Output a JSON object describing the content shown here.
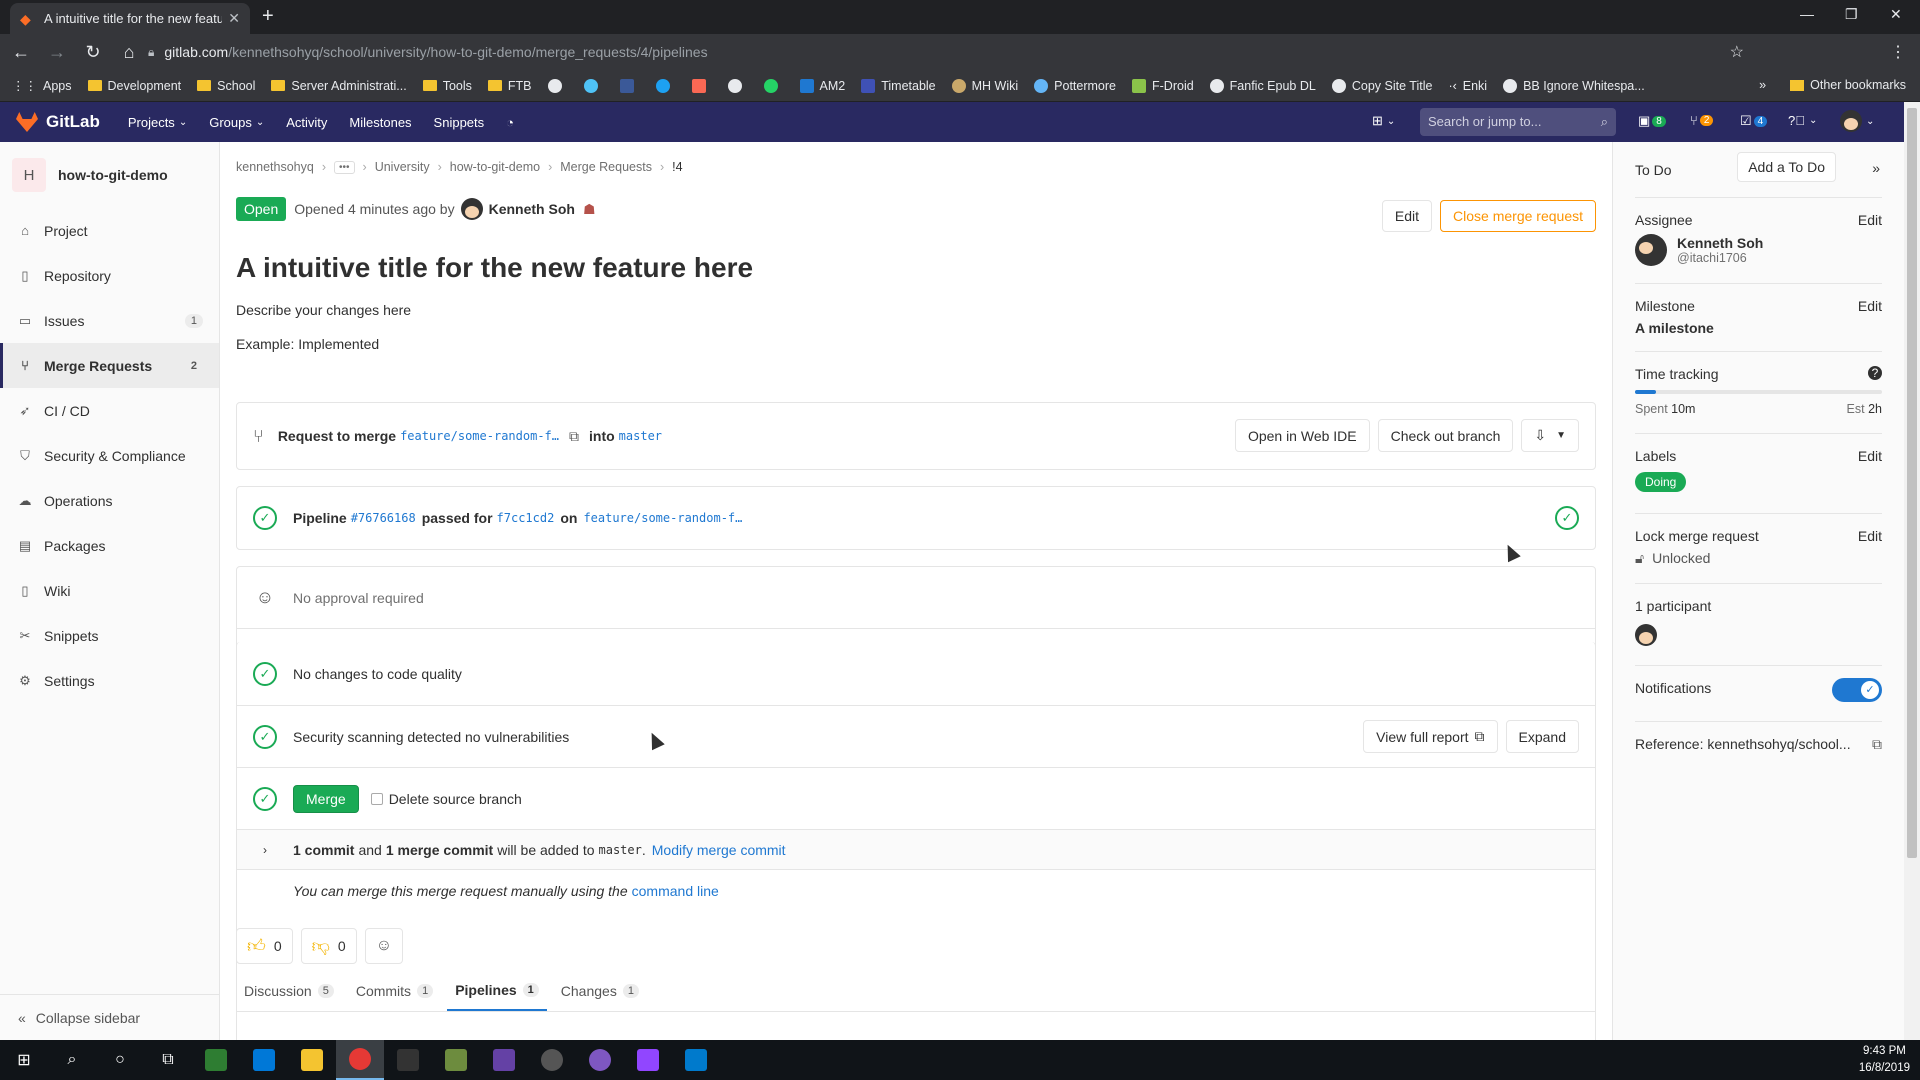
{
  "browser": {
    "tab_title": "A intuitive title for the new feature here",
    "url_host": "gitlab.com",
    "url_path": "/kennethsohyq/school/university/how-to-git-demo/merge_requests/4/pipelines",
    "bookmarks": [
      "Apps",
      "Development",
      "School",
      "Server Administrati...",
      "Tools",
      "FTB",
      "AM2",
      "Timetable",
      "MH Wiki",
      "Pottermore",
      "F-Droid",
      "Fanfic Epub DL",
      "Copy Site Title",
      "Enki",
      "BB Ignore Whitespa..."
    ],
    "other_bookmarks": "Other bookmarks"
  },
  "gitlab_nav": {
    "brand": "GitLab",
    "links": [
      "Projects",
      "Groups",
      "Activity",
      "Milestones",
      "Snippets"
    ],
    "search_placeholder": "Search or jump to...",
    "issues_badge": "8",
    "mr_badge": "2",
    "todo_badge": "4"
  },
  "sidebar": {
    "project_initial": "H",
    "project_name": "how-to-git-demo",
    "items": [
      {
        "label": "Project",
        "icon": "home-icon"
      },
      {
        "label": "Repository",
        "icon": "book-icon"
      },
      {
        "label": "Issues",
        "icon": "issues-icon",
        "count": "1"
      },
      {
        "label": "Merge Requests",
        "icon": "merge-request-icon",
        "count": "2"
      },
      {
        "label": "CI / CD",
        "icon": "rocket-icon"
      },
      {
        "label": "Security & Compliance",
        "icon": "shield-icon"
      },
      {
        "label": "Operations",
        "icon": "cloud-icon"
      },
      {
        "label": "Packages",
        "icon": "package-icon"
      },
      {
        "label": "Wiki",
        "icon": "book-icon"
      },
      {
        "label": "Snippets",
        "icon": "scissors-icon"
      },
      {
        "label": "Settings",
        "icon": "gear-icon"
      }
    ],
    "collapse_label": "Collapse sidebar"
  },
  "breadcrumb": {
    "items": [
      "kennethsohyq",
      "University",
      "how-to-git-demo",
      "Merge Requests",
      "!4"
    ]
  },
  "mr": {
    "status": "Open",
    "opened_text": "Opened 4 minutes ago by",
    "author": "Kenneth Soh",
    "edit_label": "Edit",
    "close_label": "Close merge request",
    "title": "A intuitive title for the new feature here",
    "description": "Describe your changes here",
    "example": "Example: Implemented"
  },
  "widget": {
    "request_to_merge": "Request to merge",
    "source_branch": "feature/some-random-f…",
    "into": "into",
    "target_branch": "master",
    "open_web_ide": "Open in Web IDE",
    "check_out_branch": "Check out branch",
    "pipeline_label": "Pipeline",
    "pipeline_id": "#76766168",
    "passed_for": "passed for",
    "commit_sha": "f7cc1cd2",
    "on": "on",
    "pipeline_branch": "feature/some-random-f…",
    "no_approval": "No approval required",
    "code_quality": "No changes to code quality",
    "security": "Security scanning detected no vulnerabilities",
    "view_full_report": "View full report",
    "expand": "Expand",
    "merge_button": "Merge",
    "delete_source_branch": "Delete source branch",
    "commit_count": "1 commit",
    "and": "and",
    "merge_commit_count": "1 merge commit",
    "will_be_added": "will be added to",
    "target_branch_code": "master",
    "modify_merge_commit": "Modify merge commit",
    "manual_merge_text": "You can merge this merge request manually using the",
    "command_line": "command line"
  },
  "reactions": {
    "thumbs_up": "0",
    "thumbs_down": "0"
  },
  "tabs": [
    {
      "label": "Discussion",
      "count": "5"
    },
    {
      "label": "Commits",
      "count": "1"
    },
    {
      "label": "Pipelines",
      "count": "1"
    },
    {
      "label": "Changes",
      "count": "1"
    }
  ],
  "right_sidebar": {
    "todo_label": "To Do",
    "add_todo": "Add a To Do",
    "assignee_label": "Assignee",
    "edit": "Edit",
    "assignee_name": "Kenneth Soh",
    "assignee_handle": "@itachi1706",
    "milestone_label": "Milestone",
    "milestone_value": "A milestone",
    "time_tracking_label": "Time tracking",
    "spent_text": "Spent",
    "spent_value": "10m",
    "est_text": "Est",
    "est_value": "2h",
    "time_progress": 0.083,
    "labels_label": "Labels",
    "label_doing": "Doing",
    "lock_label": "Lock merge request",
    "lock_value": "Unlocked",
    "participants_label": "1 participant",
    "notifications_label": "Notifications",
    "reference_label": "Reference: kennethsohyq/school..."
  },
  "taskbar": {
    "time": "9:43 PM",
    "date": "16/8/2019"
  }
}
